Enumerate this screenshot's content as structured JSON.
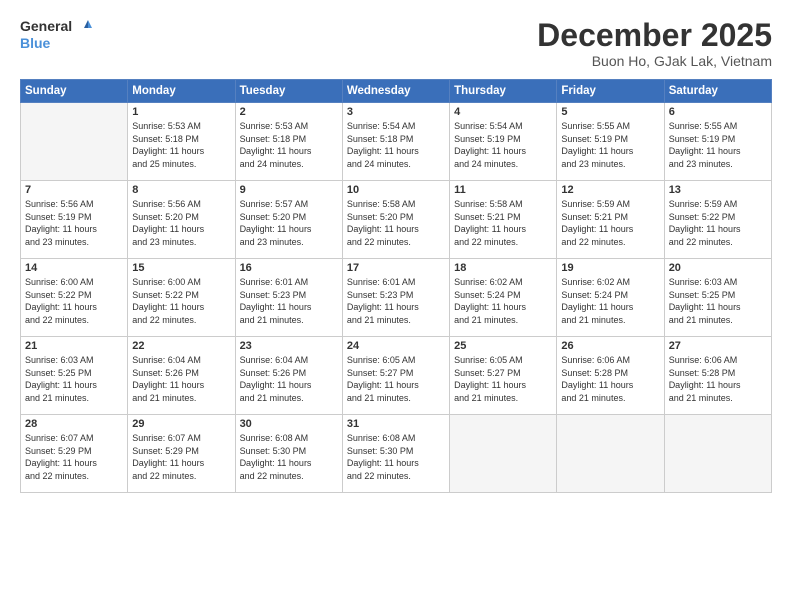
{
  "logo": {
    "line1": "General",
    "line2": "Blue"
  },
  "title": "December 2025",
  "location": "Buon Ho, GJak Lak, Vietnam",
  "header_days": [
    "Sunday",
    "Monday",
    "Tuesday",
    "Wednesday",
    "Thursday",
    "Friday",
    "Saturday"
  ],
  "weeks": [
    [
      {
        "day": "",
        "info": ""
      },
      {
        "day": "1",
        "info": "Sunrise: 5:53 AM\nSunset: 5:18 PM\nDaylight: 11 hours\nand 25 minutes."
      },
      {
        "day": "2",
        "info": "Sunrise: 5:53 AM\nSunset: 5:18 PM\nDaylight: 11 hours\nand 24 minutes."
      },
      {
        "day": "3",
        "info": "Sunrise: 5:54 AM\nSunset: 5:18 PM\nDaylight: 11 hours\nand 24 minutes."
      },
      {
        "day": "4",
        "info": "Sunrise: 5:54 AM\nSunset: 5:19 PM\nDaylight: 11 hours\nand 24 minutes."
      },
      {
        "day": "5",
        "info": "Sunrise: 5:55 AM\nSunset: 5:19 PM\nDaylight: 11 hours\nand 23 minutes."
      },
      {
        "day": "6",
        "info": "Sunrise: 5:55 AM\nSunset: 5:19 PM\nDaylight: 11 hours\nand 23 minutes."
      }
    ],
    [
      {
        "day": "7",
        "info": "Sunrise: 5:56 AM\nSunset: 5:19 PM\nDaylight: 11 hours\nand 23 minutes."
      },
      {
        "day": "8",
        "info": "Sunrise: 5:56 AM\nSunset: 5:20 PM\nDaylight: 11 hours\nand 23 minutes."
      },
      {
        "day": "9",
        "info": "Sunrise: 5:57 AM\nSunset: 5:20 PM\nDaylight: 11 hours\nand 23 minutes."
      },
      {
        "day": "10",
        "info": "Sunrise: 5:58 AM\nSunset: 5:20 PM\nDaylight: 11 hours\nand 22 minutes."
      },
      {
        "day": "11",
        "info": "Sunrise: 5:58 AM\nSunset: 5:21 PM\nDaylight: 11 hours\nand 22 minutes."
      },
      {
        "day": "12",
        "info": "Sunrise: 5:59 AM\nSunset: 5:21 PM\nDaylight: 11 hours\nand 22 minutes."
      },
      {
        "day": "13",
        "info": "Sunrise: 5:59 AM\nSunset: 5:22 PM\nDaylight: 11 hours\nand 22 minutes."
      }
    ],
    [
      {
        "day": "14",
        "info": "Sunrise: 6:00 AM\nSunset: 5:22 PM\nDaylight: 11 hours\nand 22 minutes."
      },
      {
        "day": "15",
        "info": "Sunrise: 6:00 AM\nSunset: 5:22 PM\nDaylight: 11 hours\nand 22 minutes."
      },
      {
        "day": "16",
        "info": "Sunrise: 6:01 AM\nSunset: 5:23 PM\nDaylight: 11 hours\nand 21 minutes."
      },
      {
        "day": "17",
        "info": "Sunrise: 6:01 AM\nSunset: 5:23 PM\nDaylight: 11 hours\nand 21 minutes."
      },
      {
        "day": "18",
        "info": "Sunrise: 6:02 AM\nSunset: 5:24 PM\nDaylight: 11 hours\nand 21 minutes."
      },
      {
        "day": "19",
        "info": "Sunrise: 6:02 AM\nSunset: 5:24 PM\nDaylight: 11 hours\nand 21 minutes."
      },
      {
        "day": "20",
        "info": "Sunrise: 6:03 AM\nSunset: 5:25 PM\nDaylight: 11 hours\nand 21 minutes."
      }
    ],
    [
      {
        "day": "21",
        "info": "Sunrise: 6:03 AM\nSunset: 5:25 PM\nDaylight: 11 hours\nand 21 minutes."
      },
      {
        "day": "22",
        "info": "Sunrise: 6:04 AM\nSunset: 5:26 PM\nDaylight: 11 hours\nand 21 minutes."
      },
      {
        "day": "23",
        "info": "Sunrise: 6:04 AM\nSunset: 5:26 PM\nDaylight: 11 hours\nand 21 minutes."
      },
      {
        "day": "24",
        "info": "Sunrise: 6:05 AM\nSunset: 5:27 PM\nDaylight: 11 hours\nand 21 minutes."
      },
      {
        "day": "25",
        "info": "Sunrise: 6:05 AM\nSunset: 5:27 PM\nDaylight: 11 hours\nand 21 minutes."
      },
      {
        "day": "26",
        "info": "Sunrise: 6:06 AM\nSunset: 5:28 PM\nDaylight: 11 hours\nand 21 minutes."
      },
      {
        "day": "27",
        "info": "Sunrise: 6:06 AM\nSunset: 5:28 PM\nDaylight: 11 hours\nand 21 minutes."
      }
    ],
    [
      {
        "day": "28",
        "info": "Sunrise: 6:07 AM\nSunset: 5:29 PM\nDaylight: 11 hours\nand 22 minutes."
      },
      {
        "day": "29",
        "info": "Sunrise: 6:07 AM\nSunset: 5:29 PM\nDaylight: 11 hours\nand 22 minutes."
      },
      {
        "day": "30",
        "info": "Sunrise: 6:08 AM\nSunset: 5:30 PM\nDaylight: 11 hours\nand 22 minutes."
      },
      {
        "day": "31",
        "info": "Sunrise: 6:08 AM\nSunset: 5:30 PM\nDaylight: 11 hours\nand 22 minutes."
      },
      {
        "day": "",
        "info": ""
      },
      {
        "day": "",
        "info": ""
      },
      {
        "day": "",
        "info": ""
      }
    ]
  ]
}
